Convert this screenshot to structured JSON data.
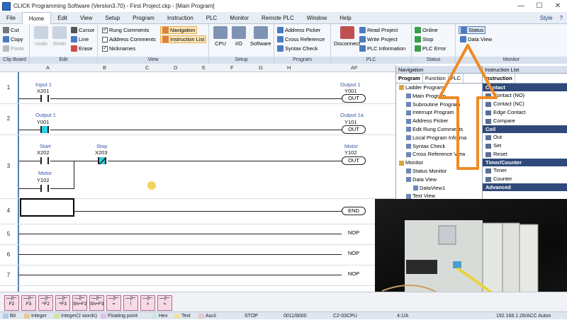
{
  "window": {
    "title": "CLICK Programming Software (Version3.70) - First Project.ckp - [Main Program]",
    "min": "—",
    "max": "☐",
    "close": "✕"
  },
  "menu": {
    "items": [
      "File",
      "Home",
      "Edit",
      "View",
      "Setup",
      "Program",
      "Instruction",
      "PLC",
      "Monitor",
      "Remote PLC",
      "Window",
      "Help"
    ],
    "style": "Style",
    "help_icon": "?"
  },
  "ribbon": {
    "clipboard": {
      "cut": "Cut",
      "copy": "Copy",
      "paste": "Paste",
      "label": "Clip Board"
    },
    "edit": {
      "undo": "Undo",
      "redo": "Redo",
      "cursor": "Cursor",
      "line": "Line",
      "erase": "Erase",
      "label": "Edit"
    },
    "view": {
      "rung_comments": "Rung Comments",
      "address_comments": "Address Comments",
      "nicknames": "Nicknames",
      "navigation": "Navigation",
      "instruction_list": "Instruction List",
      "label": "View"
    },
    "setup": {
      "cpu": "CPU",
      "io": "I/O",
      "software": "Software",
      "label": "Setup"
    },
    "program": {
      "address_picker": "Address Picker",
      "cross_reference": "Cross Reference",
      "syntax_check": "Syntax Check",
      "label": "Program"
    },
    "plc": {
      "disconnect": "Disconnect",
      "read_project": "Read Project",
      "write_project": "Write Project",
      "plc_information": "PLC Information",
      "label": "PLC"
    },
    "status": {
      "online": "Online",
      "stop": "Stop",
      "plc_error": "PLC Error",
      "label": "Status"
    },
    "monitor": {
      "status": "Status",
      "data_view": "Data View",
      "label": "Monitor"
    }
  },
  "ladder": {
    "columns": [
      "A",
      "B",
      "C",
      "D",
      "E",
      "F",
      "G",
      "H",
      "AF"
    ],
    "rows": [
      "1",
      "2",
      "3",
      "4",
      "5",
      "6",
      "7"
    ],
    "rung1": {
      "nick": "Input 1",
      "addr": "X201",
      "coil_nick": "Output 1",
      "coil_addr": "Y001",
      "coil": "OUT"
    },
    "rung2": {
      "nick": "Output 1",
      "addr": "Y001",
      "coil_nick": "Output 1a",
      "coil_addr": "Y101",
      "coil": "OUT"
    },
    "rung3": {
      "nick_a": "Start",
      "addr_a": "X202",
      "nick_b": "Stop",
      "addr_b": "X203",
      "nick_c": "Motor",
      "addr_c": "Y102",
      "coil_nick": "Motor",
      "coil_addr": "Y102",
      "coil": "OUT"
    },
    "rung4": {
      "coil": "END"
    },
    "rung5": {
      "coil": "NOP"
    },
    "rung6": {
      "coil": "NOP"
    },
    "rung7": {
      "coil": "NOP"
    }
  },
  "navigation": {
    "title": "Navigation",
    "tabs": [
      "Program",
      "Function",
      "PLC"
    ],
    "tree": [
      "Ladder Program",
      "Main Program",
      "Subroutine Program",
      "Interrupt Program",
      "Address Picker",
      "Edit Rung Comments",
      "Local Program Informa",
      "Syntax Check",
      "Cross Reference View",
      "Monitor",
      "Status Monitor",
      "Data View",
      "DataView1",
      "Text View"
    ]
  },
  "instruction_list": {
    "title": "Instruction List",
    "tab": "Instruction",
    "sections": {
      "contact": "Contact",
      "coil": "Coil",
      "timer_counter": "Timer/Counter",
      "advanced": "Advanced"
    },
    "contact_items": [
      "Contact (NO)",
      "Contact (NC)",
      "Edge Contact",
      "Compare"
    ],
    "coil_items": [
      "Out",
      "Set",
      "Reset"
    ],
    "timer_items": [
      "Timer",
      "Counter"
    ]
  },
  "instruction_bar": [
    "F2",
    "F3",
    "^F2",
    "^F3",
    "Sh+F2",
    "Sh+F3",
    "=",
    "!",
    ">",
    "<"
  ],
  "status_bar": {
    "bit": "Bit",
    "integer": "Integer",
    "integer2": "Integer(2 words)",
    "floating": "Floating point",
    "hex": "Hex",
    "text": "Text",
    "ascii": "Ascii",
    "mode": "STOP",
    "steps": "0011/8000",
    "cpu": "C2-03CPU",
    "position": "4:1/A",
    "ip": "192.168.1.26/ACC Auton"
  },
  "colors": {
    "accent": "#f08a24",
    "coil_active": "#2fd0e0",
    "ribbon_bg": "#f4f7fb",
    "section_header": "#2f4a7a"
  }
}
